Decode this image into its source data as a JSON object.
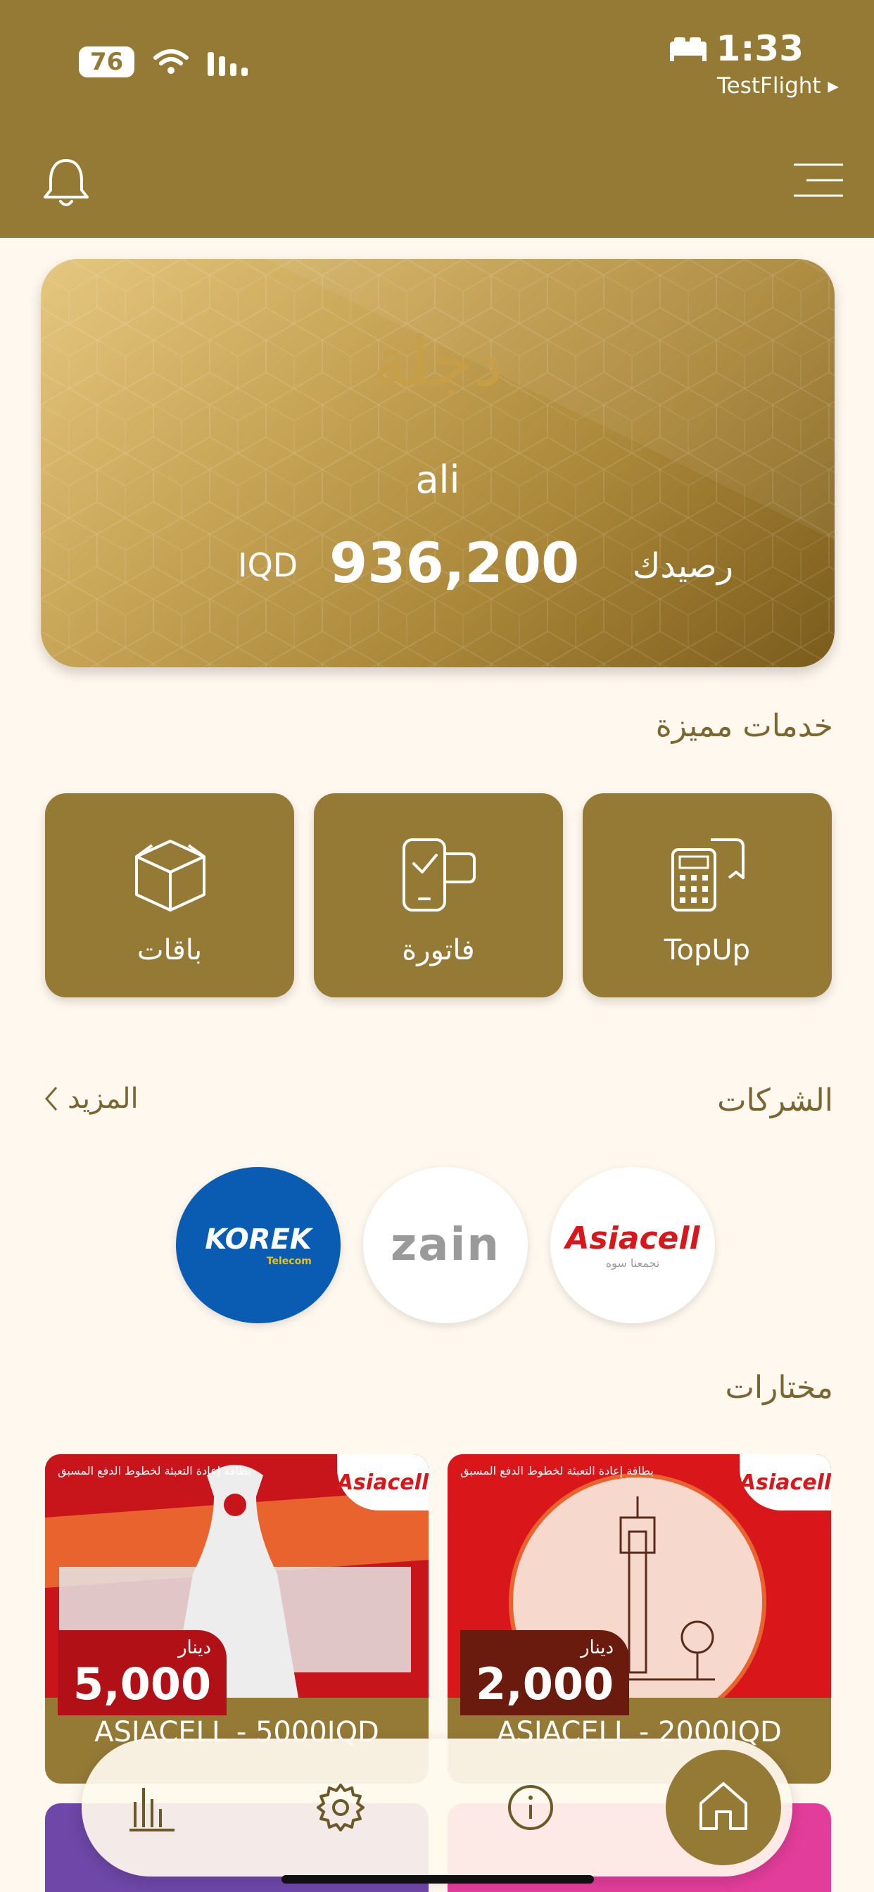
{
  "status_bar": {
    "time": "1:33",
    "back_app": "TestFlight",
    "battery": "76"
  },
  "header": {
    "bell_icon": "bell-icon",
    "menu_icon": "menu-icon"
  },
  "balance_card": {
    "logo_text": "دجلة",
    "user_name": "ali",
    "amount": "936,200",
    "currency": "IQD",
    "balance_label": "رصيدك"
  },
  "featured_services": {
    "title": "خدمات مميزة",
    "items": [
      {
        "label": "TopUp",
        "icon": "receipt-icon"
      },
      {
        "label": "فاتورة",
        "icon": "phone-check-icon"
      },
      {
        "label": "باقات",
        "icon": "box-icon"
      }
    ]
  },
  "companies": {
    "title": "الشركات",
    "more_label": "المزيد",
    "items": [
      {
        "name": "Asiacell",
        "sub": "تجمعنا سوه"
      },
      {
        "name": "zain"
      },
      {
        "name": "KOREK",
        "sub": "Telecom"
      }
    ]
  },
  "picks": {
    "title": "مختارات",
    "items": [
      {
        "name": "ASIACELL - 2000IQD",
        "price": "2,000",
        "currency": "دينار",
        "brand": "Asiacell"
      },
      {
        "name": "ASIACELL - 5000IQD",
        "price": "5,000",
        "currency": "دينار",
        "brand": "Asiacell"
      }
    ]
  },
  "bottom_nav": {
    "items": [
      "chart-icon",
      "settings-icon",
      "info-icon",
      "home-icon"
    ]
  },
  "colors": {
    "primary": "#957A36",
    "background": "#FFF8EE",
    "asiacell_red": "#D9161A",
    "korek_blue": "#0A5CB3"
  }
}
